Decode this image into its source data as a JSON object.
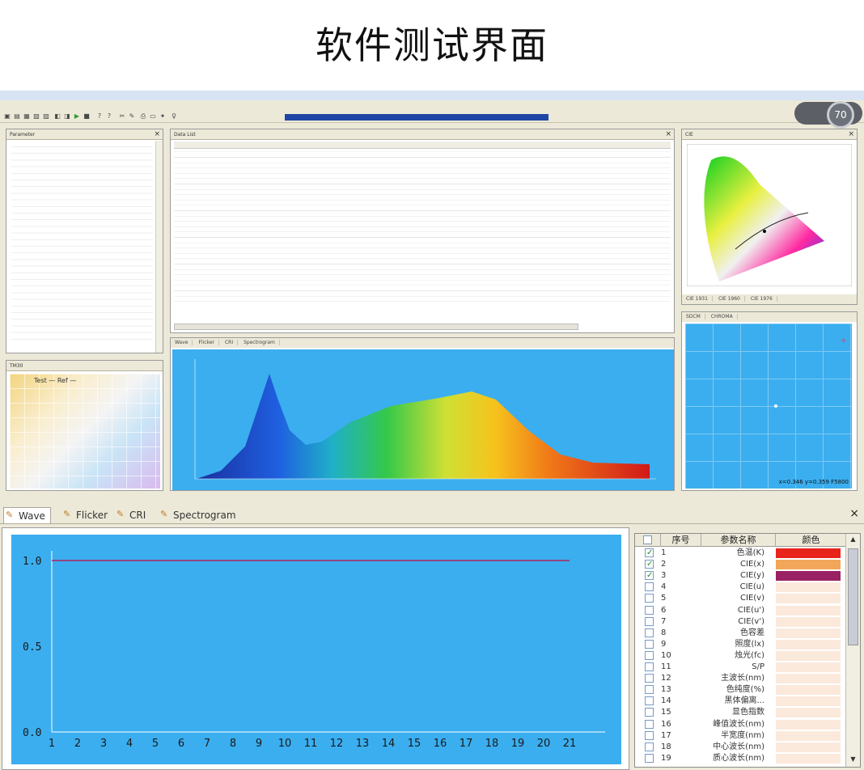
{
  "headline": "软件测试界面",
  "gauge": {
    "value": "70"
  },
  "panels": {
    "parameter": "Parameter",
    "data_list": "Data List",
    "cie": "CIE",
    "tm30": "TM30",
    "sdcm": "SDCM",
    "chroma": "CHROMA"
  },
  "mini_tabs": [
    "Wave",
    "Flicker",
    "CRI",
    "Spectrogram"
  ],
  "cie_tabs": [
    "CIE 1931",
    "CIE 1960",
    "CIE 1976"
  ],
  "tm30_legend": {
    "test": "Test",
    "ref": "Ref"
  },
  "sdcm_readout": "x=0.346 y=0.359 F5800",
  "bottom_tabs": [
    "Wave",
    "Flicker",
    "CRI",
    "Spectrogram"
  ],
  "wave_chart": {
    "chart_data": {
      "type": "line",
      "x": [
        1,
        2,
        3,
        4,
        5,
        6,
        7,
        8,
        9,
        10,
        11,
        12,
        13,
        14,
        15,
        16,
        17,
        18,
        19,
        20,
        21
      ],
      "ylim": [
        0,
        1.0
      ],
      "yticks": [
        "0.0",
        "0.5",
        "1.0"
      ],
      "series": [
        {
          "values": [
            1,
            1,
            1,
            1,
            1,
            1,
            1,
            1,
            1,
            1,
            1,
            1,
            1,
            1,
            1,
            1,
            1,
            1,
            1,
            1,
            1
          ],
          "color": "#b0245a"
        }
      ]
    }
  },
  "param_table": {
    "headers": [
      "序号",
      "参数名称",
      "颜色"
    ],
    "rows": [
      {
        "seq": "1",
        "name": "色温(K)",
        "checked": true,
        "color": "#e8231a"
      },
      {
        "seq": "2",
        "name": "CIE(x)",
        "checked": true,
        "color": "#f2a65a"
      },
      {
        "seq": "3",
        "name": "CIE(y)",
        "checked": true,
        "color": "#9a2163"
      },
      {
        "seq": "4",
        "name": "CIE(u)",
        "checked": false,
        "color": "#fbe9dc"
      },
      {
        "seq": "5",
        "name": "CIE(v)",
        "checked": false,
        "color": "#fbe9dc"
      },
      {
        "seq": "6",
        "name": "CIE(u')",
        "checked": false,
        "color": "#fbe9dc"
      },
      {
        "seq": "7",
        "name": "CIE(v')",
        "checked": false,
        "color": "#fbe9dc"
      },
      {
        "seq": "8",
        "name": "色容差",
        "checked": false,
        "color": "#fbe9dc"
      },
      {
        "seq": "9",
        "name": "照度(lx)",
        "checked": false,
        "color": "#fbe9dc"
      },
      {
        "seq": "10",
        "name": "烛光(fc)",
        "checked": false,
        "color": "#fbe9dc"
      },
      {
        "seq": "11",
        "name": "S/P",
        "checked": false,
        "color": "#fbe9dc"
      },
      {
        "seq": "12",
        "name": "主波长(nm)",
        "checked": false,
        "color": "#fbe9dc"
      },
      {
        "seq": "13",
        "name": "色纯度(%)",
        "checked": false,
        "color": "#fbe9dc"
      },
      {
        "seq": "14",
        "name": "黑体偏离...",
        "checked": false,
        "color": "#fbe9dc"
      },
      {
        "seq": "15",
        "name": "显色指数",
        "checked": false,
        "color": "#fbe9dc"
      },
      {
        "seq": "16",
        "name": "峰值波长(nm)",
        "checked": false,
        "color": "#fbe9dc"
      },
      {
        "seq": "17",
        "name": "半宽度(nm)",
        "checked": false,
        "color": "#fbe9dc"
      },
      {
        "seq": "18",
        "name": "中心波长(nm)",
        "checked": false,
        "color": "#fbe9dc"
      },
      {
        "seq": "19",
        "name": "质心波长(nm)",
        "checked": false,
        "color": "#fbe9dc"
      }
    ]
  },
  "colors": {
    "plot_bg": "#3baeef",
    "progress": "#1e46a6"
  }
}
